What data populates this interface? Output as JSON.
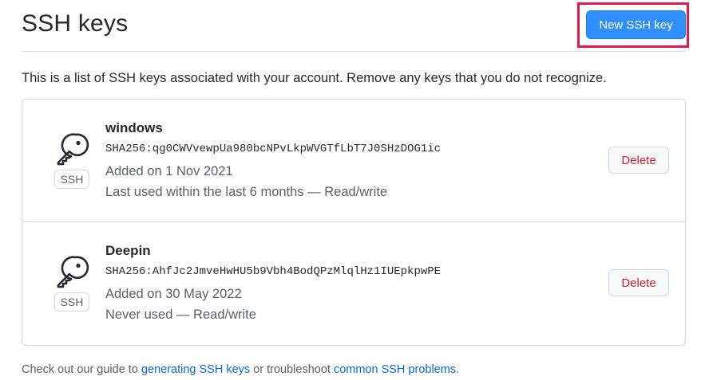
{
  "header": {
    "title": "SSH keys",
    "new_key_label": "New SSH key"
  },
  "intro": "This is a list of SSH keys associated with your account. Remove any keys that you do not recognize.",
  "keys": [
    {
      "name": "windows",
      "fingerprint": "SHA256:qg0CWVvewpUa980bcNPvLkpWVGTfLbT7J0SHzDOG1ic",
      "added": "Added on 1 Nov 2021",
      "usage": "Last used within the last 6 months — Read/write",
      "badge": "SSH",
      "delete_label": "Delete",
      "icon": "key-icon"
    },
    {
      "name": "Deepin",
      "fingerprint": "SHA256:AhfJc2JmveHwHU5b9Vbh4BodQPzMlqlHz1IUEpkpwPE",
      "added": "Added on 30 May 2022",
      "usage": "Never used — Read/write",
      "badge": "SSH",
      "delete_label": "Delete",
      "icon": "key-icon"
    }
  ],
  "footer": {
    "prefix": "Check out our guide to ",
    "link1": "generating SSH keys",
    "middle": " or troubleshoot ",
    "link2": "common SSH problems",
    "suffix": "."
  },
  "colors": {
    "primary_button": "#2f8fff",
    "highlight": "#e5194d",
    "danger": "#cf222e",
    "link": "#0969da"
  }
}
